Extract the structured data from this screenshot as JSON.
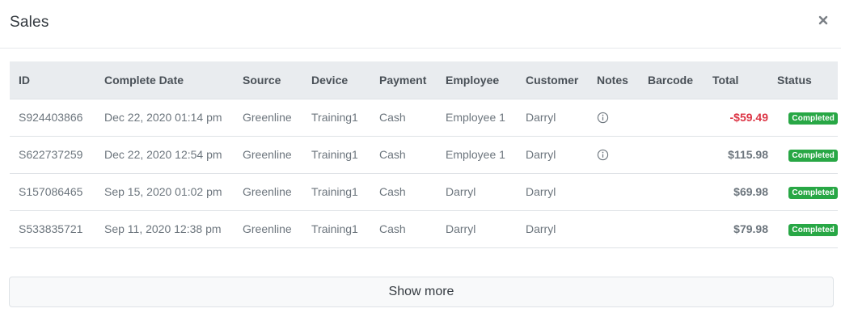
{
  "modal": {
    "title": "Sales",
    "close_icon": "close-icon",
    "show_more_label": "Show more"
  },
  "table": {
    "headers": {
      "id": "ID",
      "complete_date": "Complete Date",
      "source": "Source",
      "device": "Device",
      "payment": "Payment",
      "employee": "Employee",
      "customer": "Customer",
      "notes": "Notes",
      "barcode": "Barcode",
      "total": "Total",
      "status": "Status"
    },
    "rows": [
      {
        "id": "S924403866",
        "complete_date": "Dec 22, 2020 01:14 pm",
        "source": "Greenline",
        "device": "Training1",
        "payment": "Cash",
        "employee": "Employee 1",
        "customer": "Darryl",
        "has_note": true,
        "barcode": "",
        "total": "-$59.49",
        "negative": true,
        "status": "Completed"
      },
      {
        "id": "S622737259",
        "complete_date": "Dec 22, 2020 12:54 pm",
        "source": "Greenline",
        "device": "Training1",
        "payment": "Cash",
        "employee": "Employee 1",
        "customer": "Darryl",
        "has_note": true,
        "barcode": "",
        "total": "$115.98",
        "negative": false,
        "status": "Completed"
      },
      {
        "id": "S157086465",
        "complete_date": "Sep 15, 2020 01:02 pm",
        "source": "Greenline",
        "device": "Training1",
        "payment": "Cash",
        "employee": "Darryl",
        "customer": "Darryl",
        "has_note": false,
        "barcode": "",
        "total": "$69.98",
        "negative": false,
        "status": "Completed"
      },
      {
        "id": "S533835721",
        "complete_date": "Sep 11, 2020 12:38 pm",
        "source": "Greenline",
        "device": "Training1",
        "payment": "Cash",
        "employee": "Darryl",
        "customer": "Darryl",
        "has_note": false,
        "barcode": "",
        "total": "$79.98",
        "negative": false,
        "status": "Completed"
      }
    ]
  },
  "colors": {
    "negative_total": "#dc3545",
    "status_badge": "#28a745",
    "header_bg": "#e9ecef"
  }
}
